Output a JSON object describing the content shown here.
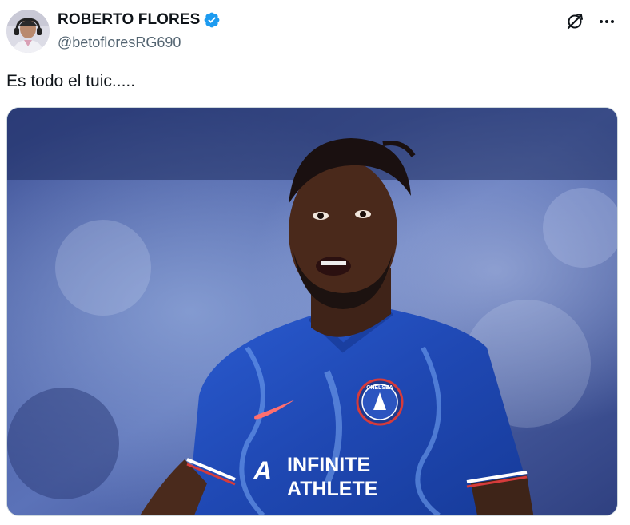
{
  "tweet": {
    "author": {
      "display_name": "ROBERTO FLORES",
      "handle": "@betofloresRG690",
      "verified": true,
      "verified_color": "#1d9bf0"
    },
    "text": "Es todo el tuic.....",
    "media": {
      "jersey_sponsor_line1": "INFINITE",
      "jersey_sponsor_line2": "ATHLETE",
      "crest_text": "CHELSEA",
      "kit_color": "#2351b8"
    },
    "actions": {
      "grok_icon": "grok-icon",
      "more_icon": "more-icon"
    }
  }
}
